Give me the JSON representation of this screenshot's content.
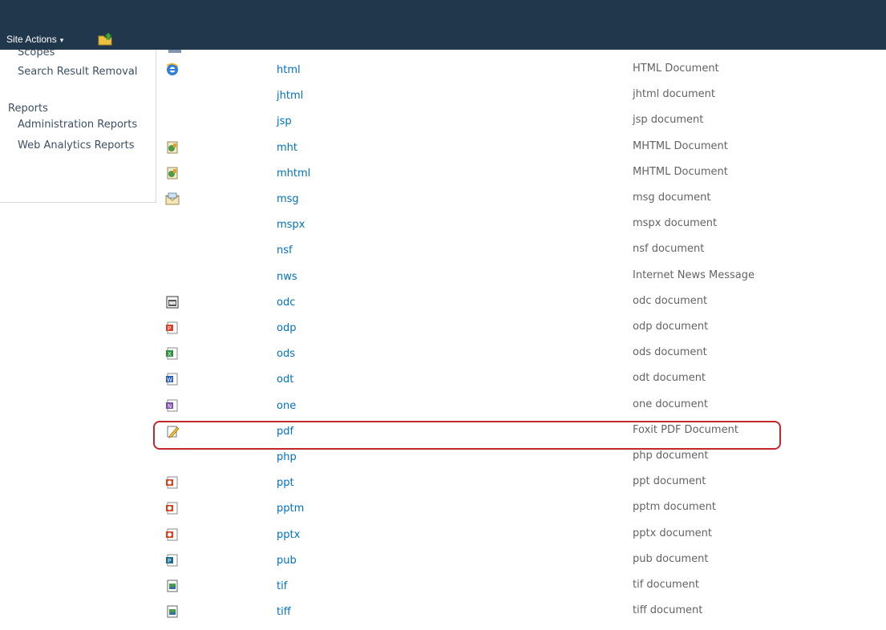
{
  "ribbon": {
    "site_actions_label": "Site Actions",
    "site_actions_caret": "▾",
    "navigate_up_icon": "folder-up-icon"
  },
  "leftnav": {
    "scopes": "Scopes",
    "search_result_removal": "Search Result Removal",
    "reports_heading": "Reports",
    "administration_reports": "Administration Reports",
    "web_analytics_reports": "Web Analytics Reports"
  },
  "colors": {
    "ribbon_bg": "#21374c",
    "link": "#0072bc",
    "description_text": "#636363",
    "highlight_border": "#c0282e"
  },
  "rows": [
    {
      "icon": "internet-explorer-icon",
      "ext": "html",
      "desc": "HTML Document"
    },
    {
      "icon": "",
      "ext": "jhtml",
      "desc": "jhtml document"
    },
    {
      "icon": "",
      "ext": "jsp",
      "desc": "jsp document"
    },
    {
      "icon": "mht-web-archive-icon",
      "ext": "mht",
      "desc": "MHTML Document"
    },
    {
      "icon": "mht-web-archive-icon",
      "ext": "mhtml",
      "desc": "MHTML Document"
    },
    {
      "icon": "email-message-icon",
      "ext": "msg",
      "desc": "msg document"
    },
    {
      "icon": "",
      "ext": "mspx",
      "desc": "mspx document"
    },
    {
      "icon": "",
      "ext": "nsf",
      "desc": "nsf document"
    },
    {
      "icon": "",
      "ext": "nws",
      "desc": "Internet News Message"
    },
    {
      "icon": "data-connection-icon",
      "ext": "odc",
      "desc": "odc document"
    },
    {
      "icon": "presentation-doc-icon",
      "ext": "odp",
      "desc": "odp document"
    },
    {
      "icon": "spreadsheet-doc-icon",
      "ext": "ods",
      "desc": "ods document"
    },
    {
      "icon": "word-doc-icon",
      "ext": "odt",
      "desc": "odt document"
    },
    {
      "icon": "onenote-doc-icon",
      "ext": "one",
      "desc": "one document"
    },
    {
      "icon": "foxit-pdf-icon",
      "ext": "pdf",
      "desc": "Foxit PDF Document"
    },
    {
      "icon": "",
      "ext": "php",
      "desc": "php document"
    },
    {
      "icon": "powerpoint-doc-icon",
      "ext": "ppt",
      "desc": "ppt document"
    },
    {
      "icon": "powerpoint-doc-icon",
      "ext": "pptm",
      "desc": "pptm document"
    },
    {
      "icon": "powerpoint-doc-icon",
      "ext": "pptx",
      "desc": "pptx document"
    },
    {
      "icon": "publisher-doc-icon",
      "ext": "pub",
      "desc": "pub document"
    },
    {
      "icon": "image-doc-icon",
      "ext": "tif",
      "desc": "tif document"
    },
    {
      "icon": "image-doc-icon",
      "ext": "tiff",
      "desc": "tiff document"
    }
  ]
}
